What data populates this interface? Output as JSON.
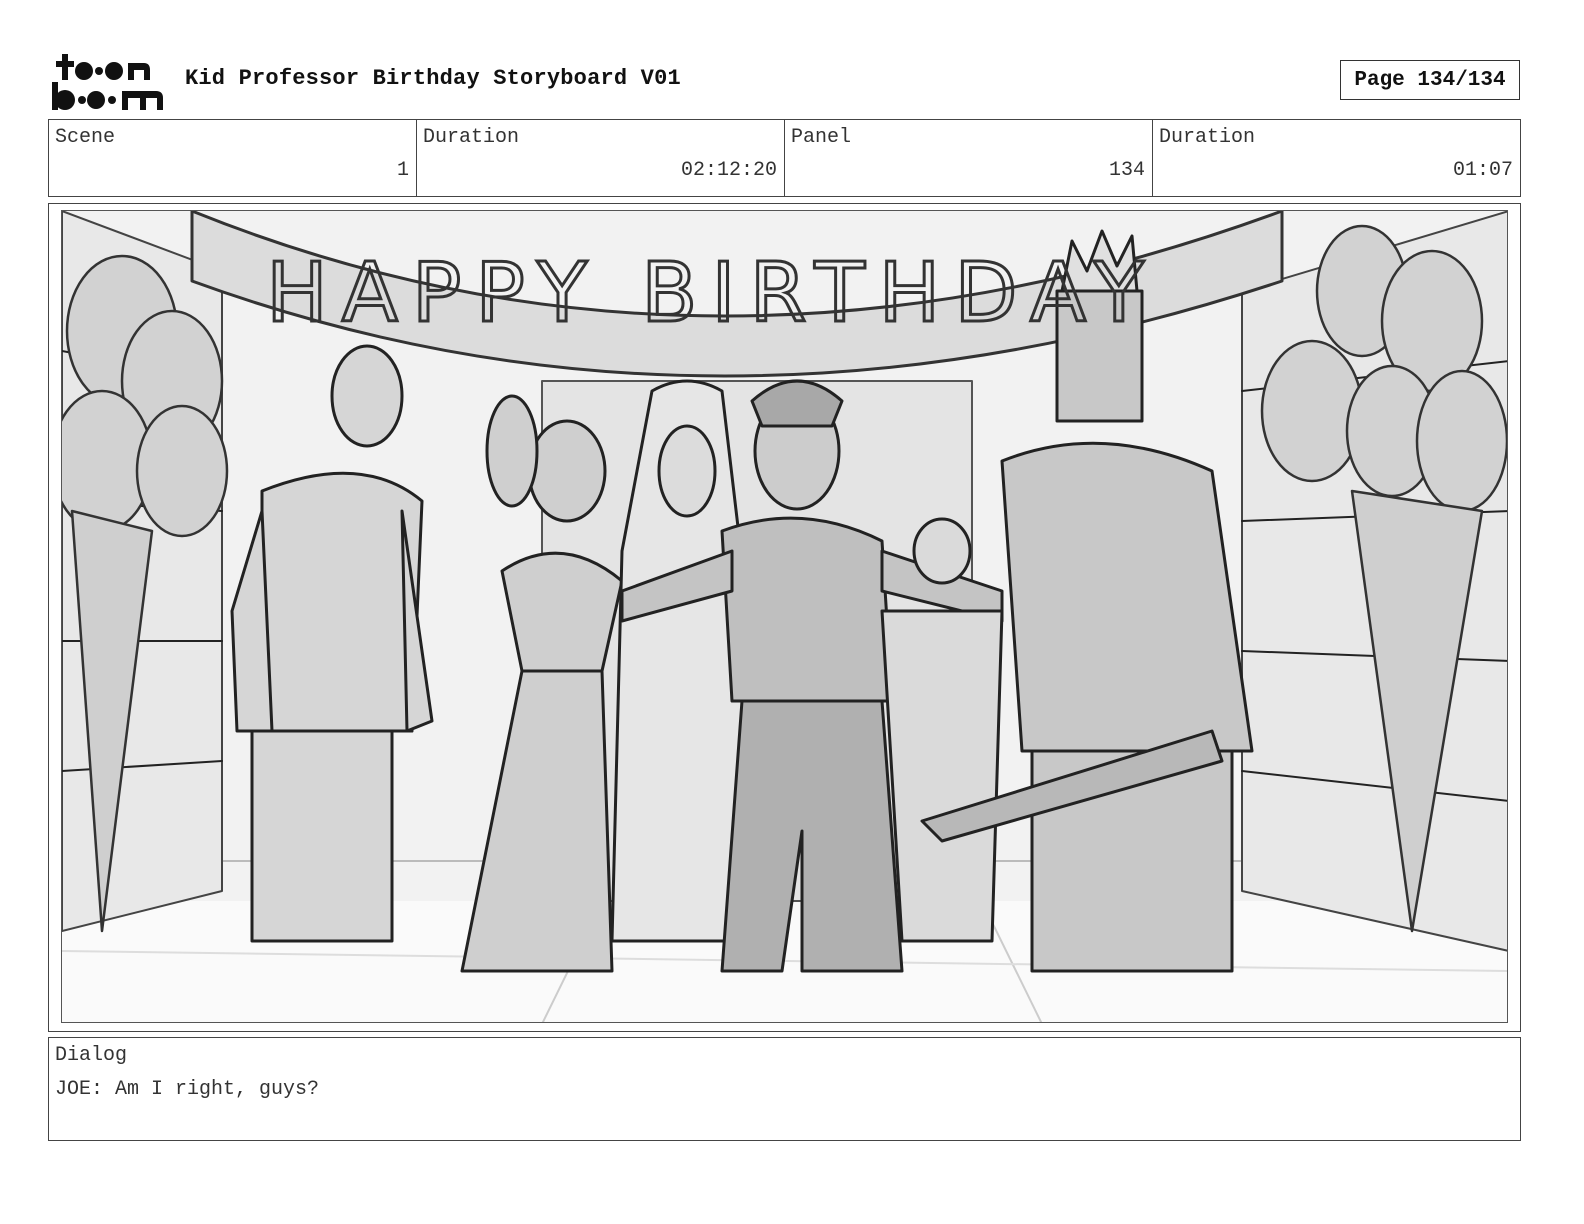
{
  "header": {
    "logo_text": "toon boom",
    "title": "Kid Professor Birthday Storyboard V01",
    "page": "Page 134/134"
  },
  "info": {
    "scene_label": "Scene",
    "scene_value": "1",
    "duration_label": "Duration",
    "duration_value": "02:12:20",
    "panel_label": "Panel",
    "panel_value": "134",
    "panel_duration_label": "Duration",
    "panel_duration_value": "01:07"
  },
  "panel": {
    "banner_text": "HAPPY BIRTHDAY"
  },
  "dialog": {
    "label": "Dialog",
    "text": "JOE: Am I right, guys?"
  }
}
